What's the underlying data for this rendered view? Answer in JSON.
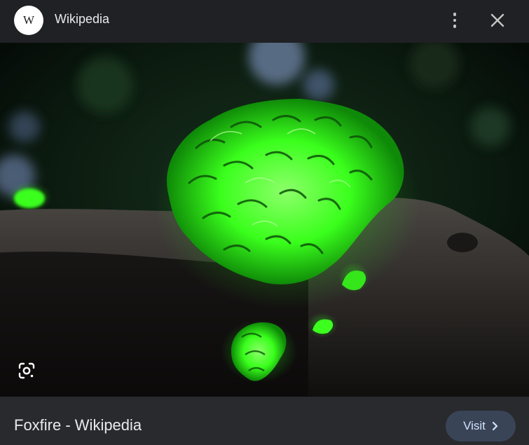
{
  "header": {
    "logo_letter": "W",
    "site_name": "Wikipedia",
    "more_icon": "more-vertical-icon",
    "close_icon": "close-icon"
  },
  "image": {
    "subject": "glowing green fungus on log",
    "lens_icon": "google-lens-icon"
  },
  "footer": {
    "page_title": "Foxfire - Wikipedia",
    "visit_label": "Visit",
    "visit_icon": "chevron-right-icon"
  },
  "colors": {
    "background": "#202124",
    "footer_background": "#292a2d",
    "visit_button": "#394457",
    "visit_text": "#d3e3fd",
    "glow": "#39ff14"
  }
}
